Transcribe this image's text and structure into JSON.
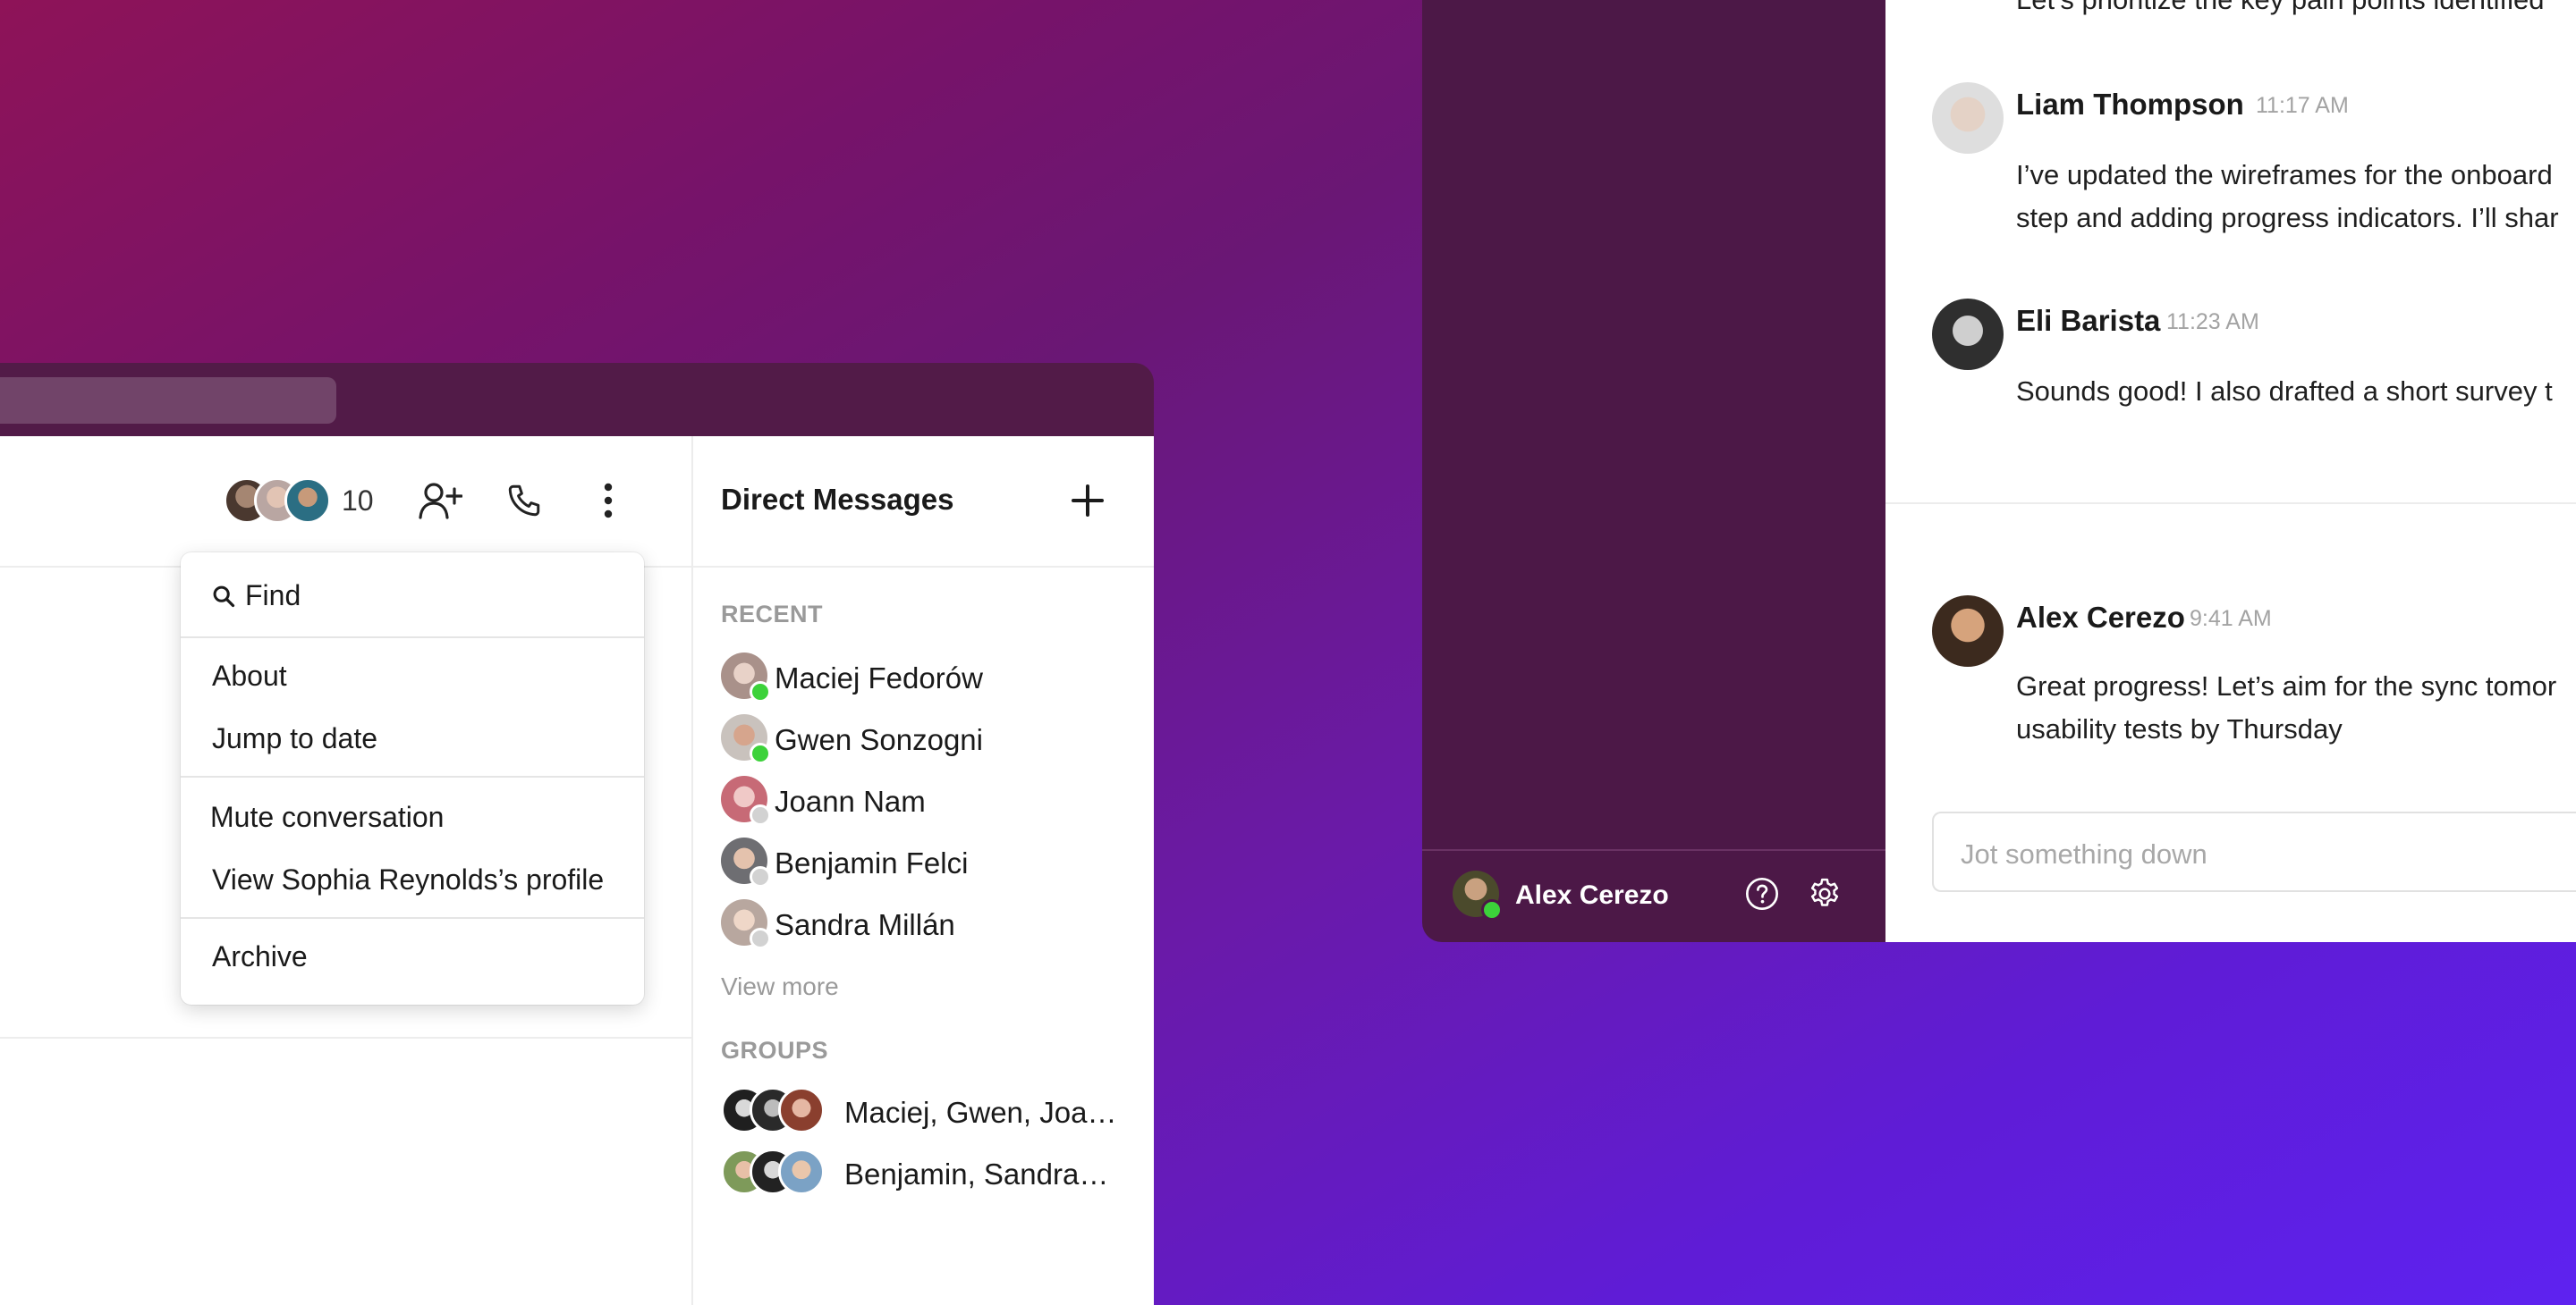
{
  "left_window": {
    "member_count": "10",
    "menu": {
      "find_label": "Find",
      "about_label": "About",
      "jump_label": "Jump to date",
      "mute_label": "Mute conversation",
      "profile_label": "View Sophia Reynolds’s profile",
      "archive_label": "Archive"
    },
    "direct_messages": {
      "title": "Direct Messages",
      "recent_label": "RECENT",
      "recent": [
        {
          "name": "Maciej Fedorów",
          "status": "online"
        },
        {
          "name": "Gwen Sonzogni",
          "status": "online"
        },
        {
          "name": "Joann Nam",
          "status": "offline"
        },
        {
          "name": "Benjamin Felci",
          "status": "offline"
        },
        {
          "name": "Sandra Millán",
          "status": "offline"
        }
      ],
      "view_more": "View more",
      "groups_label": "GROUPS",
      "groups": [
        {
          "name": "Maciej, Gwen, Joa…"
        },
        {
          "name": "Benjamin, Sandra…"
        }
      ]
    }
  },
  "right_window": {
    "truncated_top": "Let’s prioritize the key pain points identified",
    "messages": [
      {
        "author": "Liam Thompson",
        "time": "11:17 AM",
        "lines": [
          "I’ve updated the wireframes for the onboard",
          "step and adding progress indicators. I’ll shar"
        ]
      },
      {
        "author": "Eli Barista",
        "time": "11:23 AM",
        "lines": [
          "Sounds good! I also drafted a short survey t"
        ]
      },
      {
        "author": "Alex Cerezo",
        "time": "9:41 AM",
        "lines": [
          "Great progress! Let’s aim for the sync tomor",
          "usability tests by Thursday"
        ]
      }
    ],
    "composer_placeholder": "Jot something down",
    "current_user": {
      "name": "Alex Cerezo",
      "status": "online"
    }
  },
  "colors": {
    "online": "#3cd23a",
    "offline": "#d2d2d2",
    "sidebar": "#4c1847",
    "titlebar": "#521b48"
  }
}
